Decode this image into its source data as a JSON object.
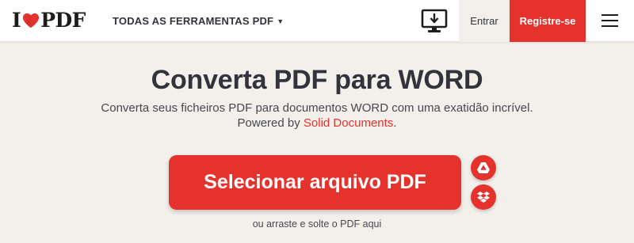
{
  "header": {
    "logo_i": "I",
    "logo_pdf": "PDF",
    "logo_heart_color": "#e5322d",
    "tools_menu_label": "TODAS AS FERRAMENTAS PDF",
    "tools_menu_icon": "caret-down-icon",
    "desktop_icon": "desktop-download-icon",
    "login_label": "Entrar",
    "signup_label": "Registre-se",
    "menu_icon": "hamburger-menu-icon"
  },
  "main": {
    "title": "Converta PDF para WORD",
    "subtitle_line1": "Converta seus ficheiros PDF para documentos WORD com uma exatidão incrível.",
    "powered_by_prefix": "Powered by ",
    "powered_by_link": "Solid Documents",
    "powered_by_suffix": ".",
    "select_button_label": "Selecionar arquivo PDF",
    "google_drive_icon": "google-drive-icon",
    "dropbox_icon": "dropbox-icon",
    "drop_hint": "ou arraste e solte o PDF aqui"
  },
  "colors": {
    "brand_red": "#e5322d",
    "background": "#f3f0ec",
    "text_dark": "#33333b"
  }
}
